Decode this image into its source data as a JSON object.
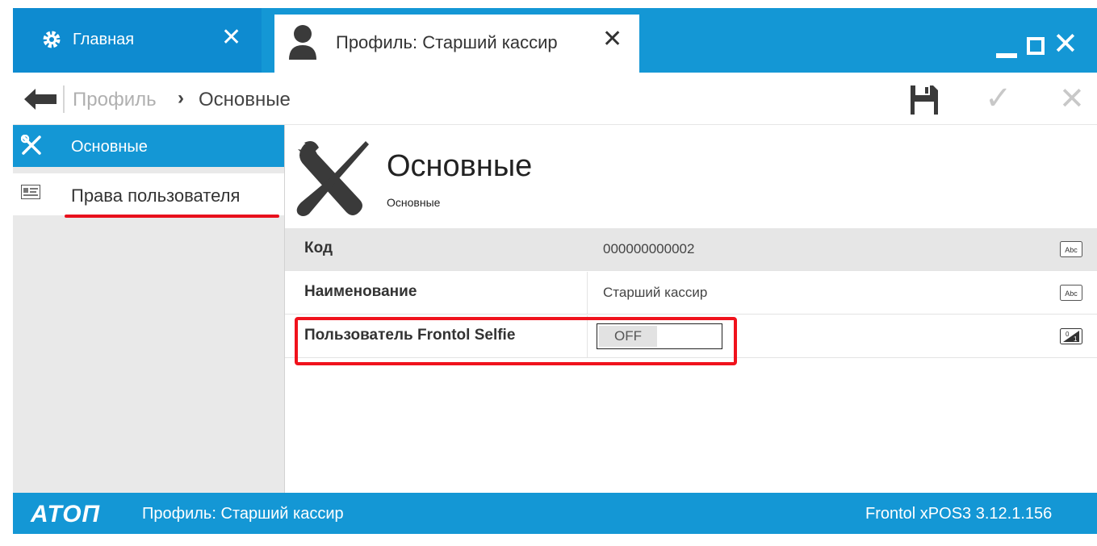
{
  "tabs": {
    "home_label": "Главная",
    "profile_label": "Профиль: Старший кассир"
  },
  "breadcrumb": {
    "root": "Профиль",
    "arrow": "›",
    "current": "Основные"
  },
  "sidebar": {
    "items": [
      {
        "label": "Основные"
      },
      {
        "label": "Права пользователя"
      }
    ]
  },
  "section": {
    "title": "Основные",
    "subtitle": "Основные"
  },
  "fields": [
    {
      "label": "Код",
      "value": "000000000002",
      "type_icon": "text-type-icon"
    },
    {
      "label": "Наименование",
      "value": "Старший кассир",
      "type_icon": "text-type-icon"
    },
    {
      "label": "Пользователь Frontol Selfie",
      "value": "OFF",
      "type_icon": "boolean-type-icon"
    }
  ],
  "statusbar": {
    "logo": "ATOΠ",
    "left": "Профиль: Старший кассир",
    "right": "Frontol xPOS3 3.12.1.156"
  },
  "colors": {
    "accent": "#1497d5",
    "highlight": "#f0121c"
  }
}
